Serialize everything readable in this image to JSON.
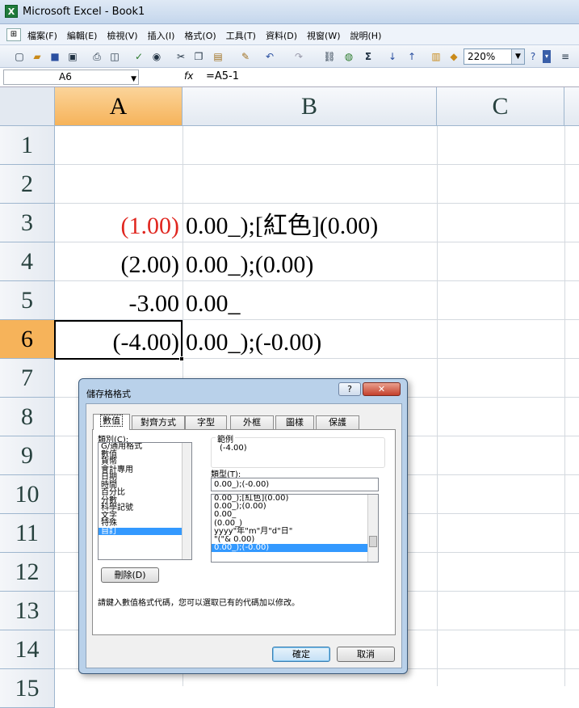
{
  "window": {
    "title": "Microsoft Excel - Book1",
    "app_icon": "X"
  },
  "menu": {
    "items": [
      "檔案(F)",
      "編輯(E)",
      "檢視(V)",
      "插入(I)",
      "格式(O)",
      "工具(T)",
      "資料(D)",
      "視窗(W)",
      "說明(H)"
    ]
  },
  "toolbar": {
    "zoom": "220%"
  },
  "formula_bar": {
    "name_box": "A6",
    "fx": "fx",
    "formula": "=A5-1"
  },
  "columns": [
    "A",
    "B",
    "C"
  ],
  "rows": [
    "1",
    "2",
    "3",
    "4",
    "5",
    "6",
    "7",
    "8",
    "9",
    "10",
    "11",
    "12",
    "13",
    "14",
    "15"
  ],
  "cells": {
    "A3": "(1.00)",
    "B3": "0.00_);[紅色](0.00)",
    "A4": "(2.00)",
    "B4": "0.00_);(0.00)",
    "A5": "-3.00",
    "B5": "0.00_",
    "A6": "(-4.00)",
    "B6": "0.00_);(-0.00)"
  },
  "colors": {
    "negative_red": "#e0261f",
    "selection_orange": "#f6b35a",
    "list_highlight": "#3399ff"
  },
  "dialog": {
    "title": "儲存格格式",
    "help": "?",
    "close": "✕",
    "tabs": [
      "數值",
      "對齊方式",
      "字型",
      "外框",
      "圖樣",
      "保護"
    ],
    "category_label": "類別(C):",
    "categories": [
      "G/通用格式",
      "數值",
      "貨幣",
      "會計專用",
      "日期",
      "時間",
      "百分比",
      "分數",
      "科學記號",
      "文字",
      "特殊",
      "自訂"
    ],
    "selected_category": "自訂",
    "sample_label": "範例",
    "sample_value": "(-4.00)",
    "type_label": "類型(T):",
    "type_value": "0.00_);(-0.00)",
    "types": [
      "0.00_);[紅色](0.00)",
      "0.00_);(0.00)",
      "0.00_",
      "(0.00_)",
      "yyyy\"年\"m\"月\"d\"日\"",
      "\"(\"& 0.00)",
      "0.00_);(-0.00)"
    ],
    "delete_button": "刪除(D)",
    "hint": "請鍵入數值格式代碼，您可以選取已有的代碼加以修改。",
    "ok": "確定",
    "cancel": "取消"
  }
}
